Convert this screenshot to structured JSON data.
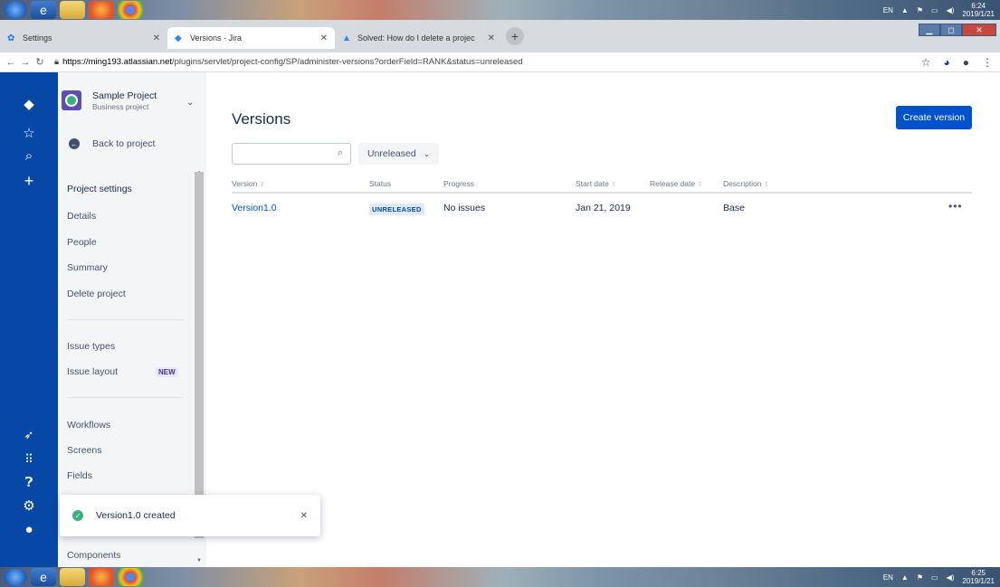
{
  "taskbar": {
    "top_lang": "EN",
    "top_time": "6:24",
    "top_date": "2019/1/21",
    "bottom_lang": "EN",
    "bottom_time": "6:25",
    "bottom_date": "2019/1/21",
    "icons": [
      "start-orb-icon",
      "internet-explorer-icon",
      "folder-icon",
      "firefox-icon",
      "chrome-icon"
    ]
  },
  "browser": {
    "tabs": [
      {
        "label": "Settings",
        "icon": "gear-icon"
      },
      {
        "label": "Versions - Jira",
        "icon": "jira-icon"
      },
      {
        "label": "Solved: How do I delete a projec",
        "icon": "atlassian-icon"
      }
    ],
    "url_host": "https://ming193.atlassian.net",
    "url_path": "/plugins/servlet/project-config/SP/administer-versions?orderField=RANK&status=unreleased"
  },
  "sidebar": {
    "project_name": "Sample Project",
    "project_type": "Business project",
    "back_label": "Back to project",
    "settings_heading": "Project settings",
    "items": [
      {
        "label": "Details"
      },
      {
        "label": "People"
      },
      {
        "label": "Summary"
      },
      {
        "label": "Delete project"
      },
      {
        "label": "Issue types"
      },
      {
        "label": "Issue layout"
      },
      {
        "label": "Workflows"
      },
      {
        "label": "Screens"
      },
      {
        "label": "Fields"
      },
      {
        "label": "Components"
      }
    ],
    "new_badge": "NEW"
  },
  "main": {
    "title": "Versions",
    "create_button": "Create version",
    "search_placeholder": "",
    "filter_label": "Unreleased",
    "columns": [
      "Version",
      "Status",
      "Progress",
      "Start date",
      "Release date",
      "Description"
    ],
    "rows": [
      {
        "version": "Version1.0",
        "status": "UNRELEASED",
        "progress": "No issues",
        "start_date": "Jan 21, 2019",
        "release_date": "",
        "description": "Base"
      }
    ],
    "row_actions": "•••"
  },
  "toast": {
    "message": "Version1.0 created"
  },
  "colors": {
    "jira_nav": "#0747a6",
    "primary_button": "#0052cc",
    "link": "#0052cc",
    "success": "#36b37e"
  }
}
